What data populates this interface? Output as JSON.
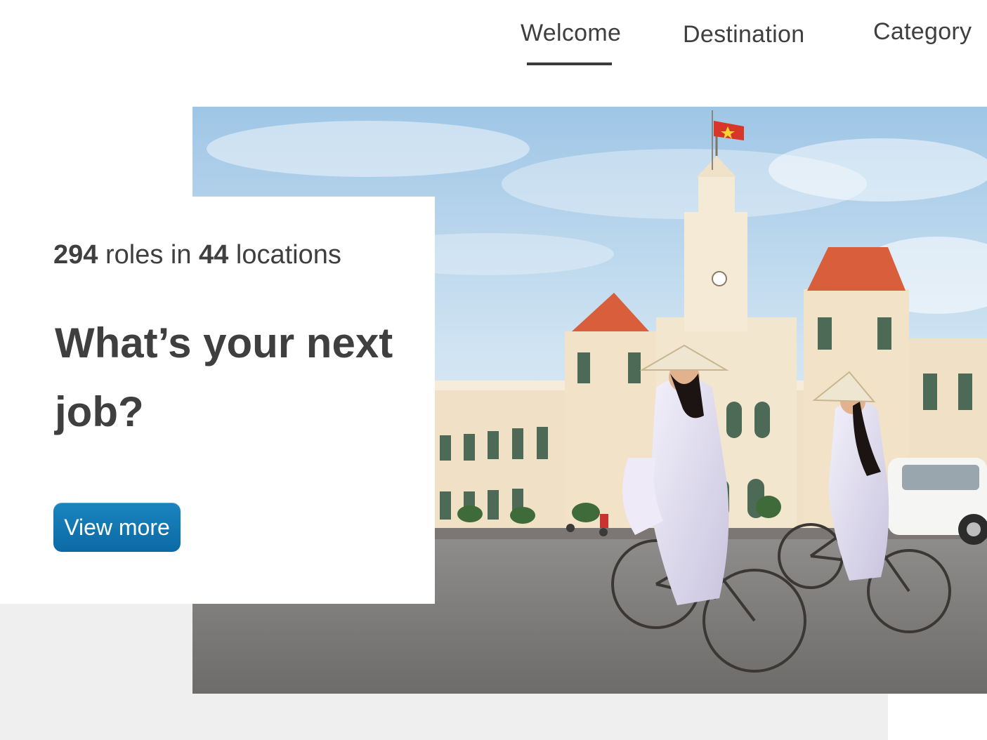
{
  "nav": {
    "items": [
      {
        "label": "Welcome",
        "active": true
      },
      {
        "label": "Destination",
        "active": false
      },
      {
        "label": "Category",
        "active": false
      }
    ]
  },
  "hero": {
    "icon": "hero-photo-city-hall-cyclists"
  },
  "card": {
    "roles_count": "294",
    "roles_text": "roles in",
    "locations_count": "44",
    "locations_text": "locations",
    "headline": "What’s your next job?",
    "button_label": "View more"
  },
  "colors": {
    "accent": "#0f74b2",
    "text": "#3f3f3f",
    "grey_block": "#efefef",
    "background": "#ffffff"
  }
}
